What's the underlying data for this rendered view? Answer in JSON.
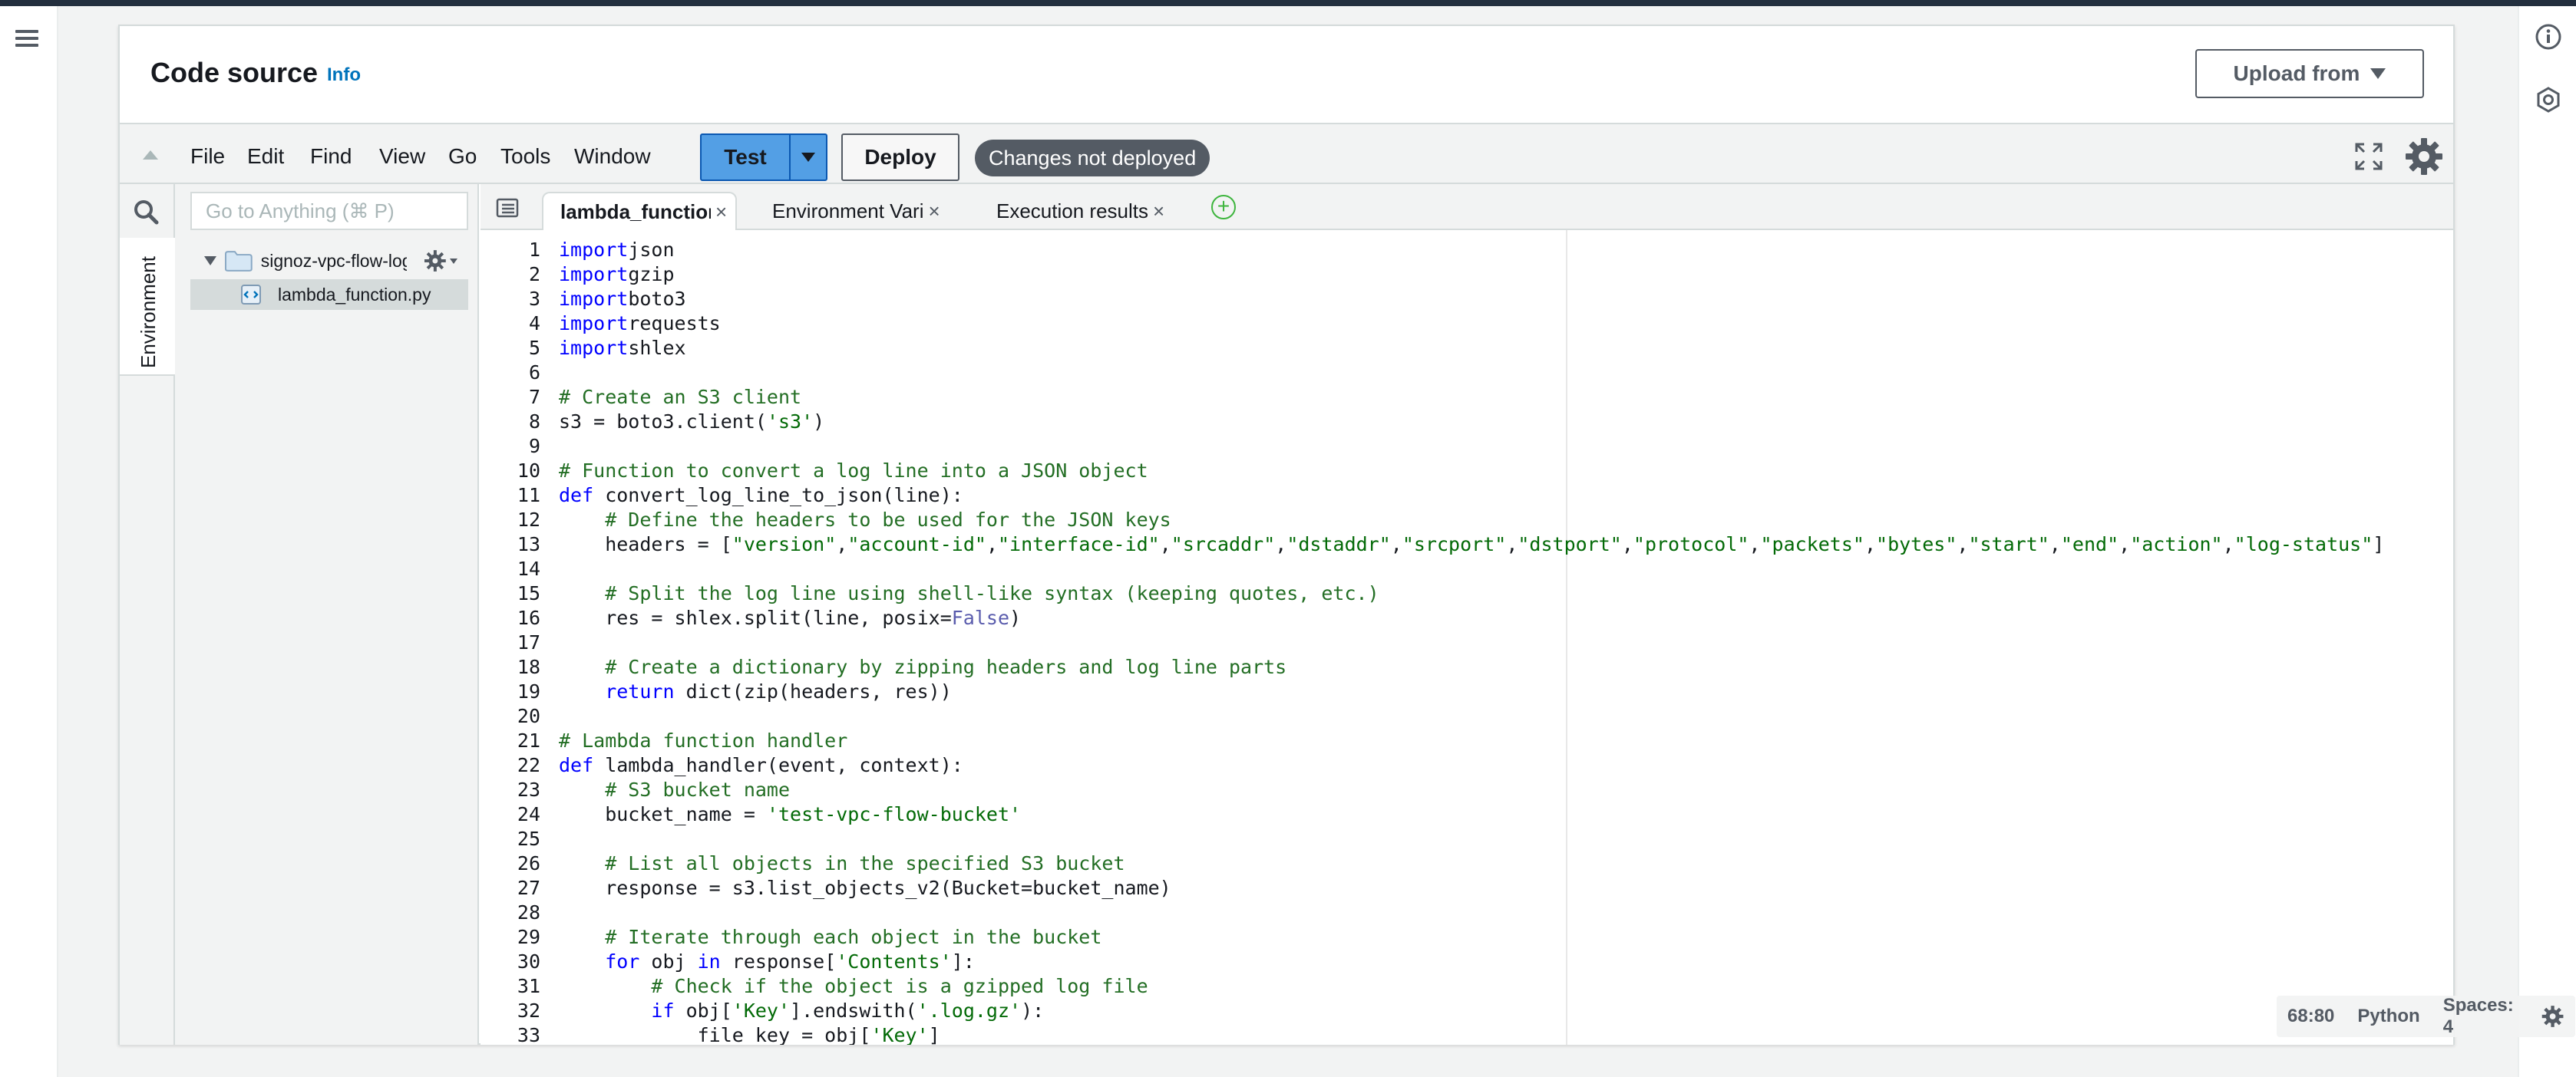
{
  "nav": {
    "menu_icon": "hamburger-icon"
  },
  "right_rail": {
    "icons": [
      "info-icon",
      "circle-diamond-icon"
    ]
  },
  "header": {
    "title": "Code source",
    "info_link": "Info",
    "upload_button": "Upload from"
  },
  "menubar": {
    "items": [
      "File",
      "Edit",
      "Find",
      "View",
      "Go",
      "Tools",
      "Window"
    ],
    "test_button": "Test",
    "deploy_button": "Deploy",
    "status": "Changes not deployed"
  },
  "sidebar": {
    "tab_label": "Environment",
    "search_placeholder": "Go to Anything (⌘ P)",
    "tree": {
      "folder": "signoz-vpc-flow-logs",
      "file": "lambda_function.py"
    }
  },
  "editor": {
    "tabs": [
      {
        "label": "lambda_function",
        "active": true
      },
      {
        "label": "Environment Vari",
        "active": false
      },
      {
        "label": "Execution results",
        "active": false
      }
    ],
    "close_glyph": "×",
    "add_glyph": "+",
    "line_numbers": [
      "1",
      "2",
      "3",
      "4",
      "5",
      "6",
      "7",
      "8",
      "9",
      "10",
      "11",
      "12",
      "13",
      "14",
      "15",
      "16",
      "17",
      "18",
      "19",
      "20",
      "21",
      "22",
      "23",
      "24",
      "25",
      "26",
      "27",
      "28",
      "29",
      "30",
      "31",
      "32",
      "33"
    ],
    "lines": [
      [
        [
          "kw",
          "import"
        ],
        [
          "",
          "json"
        ]
      ],
      [
        [
          "kw",
          "import"
        ],
        [
          "",
          "gzip"
        ]
      ],
      [
        [
          "kw",
          "import"
        ],
        [
          "",
          "boto3"
        ]
      ],
      [
        [
          "kw",
          "import"
        ],
        [
          "",
          "requests"
        ]
      ],
      [
        [
          "kw",
          "import"
        ],
        [
          "",
          "shlex"
        ]
      ],
      [],
      [
        [
          "cm",
          "# Create an S3 client"
        ]
      ],
      [
        [
          "",
          "s3 = boto3.client("
        ],
        [
          "str",
          "'s3'"
        ],
        [
          "",
          ")"
        ]
      ],
      [],
      [
        [
          "cm",
          "# Function to convert a log line into a JSON object"
        ]
      ],
      [
        [
          "kw",
          "def"
        ],
        [
          "",
          " convert_log_line_to_json(line):"
        ]
      ],
      [
        [
          "cm",
          "    # Define the headers to be used for the JSON keys"
        ]
      ],
      [
        [
          "",
          "    headers = ["
        ],
        [
          "str",
          "\"version\""
        ],
        [
          "",
          ","
        ],
        [
          "str",
          "\"account-id\""
        ],
        [
          "",
          ","
        ],
        [
          "str",
          "\"interface-id\""
        ],
        [
          "",
          ","
        ],
        [
          "str",
          "\"srcaddr\""
        ],
        [
          "",
          ","
        ],
        [
          "str",
          "\"dstaddr\""
        ],
        [
          "",
          ","
        ],
        [
          "str",
          "\"srcport\""
        ],
        [
          "",
          ","
        ],
        [
          "str",
          "\"dstport\""
        ],
        [
          "",
          ","
        ],
        [
          "str",
          "\"protocol\""
        ],
        [
          "",
          ","
        ],
        [
          "str",
          "\"packets\""
        ],
        [
          "",
          ","
        ],
        [
          "str",
          "\"bytes\""
        ],
        [
          "",
          ","
        ],
        [
          "str",
          "\"start\""
        ],
        [
          "",
          ","
        ],
        [
          "str",
          "\"end\""
        ],
        [
          "",
          ","
        ],
        [
          "str",
          "\"action\""
        ],
        [
          "",
          ","
        ],
        [
          "str",
          "\"log-status\""
        ],
        [
          "",
          "]"
        ]
      ],
      [],
      [
        [
          "cm",
          "    # Split the log line using shell-like syntax (keeping quotes, etc.)"
        ]
      ],
      [
        [
          "",
          "    res = shlex.split(line, posix="
        ],
        [
          "cst",
          "False"
        ],
        [
          "",
          ")"
        ]
      ],
      [],
      [
        [
          "cm",
          "    # Create a dictionary by zipping headers and log line parts"
        ]
      ],
      [
        [
          "kw",
          "    return"
        ],
        [
          "",
          " dict(zip(headers, res))"
        ]
      ],
      [],
      [
        [
          "cm",
          "# Lambda function handler"
        ]
      ],
      [
        [
          "kw",
          "def"
        ],
        [
          "",
          " lambda_handler(event, context):"
        ]
      ],
      [
        [
          "cm",
          "    # S3 bucket name"
        ]
      ],
      [
        [
          "",
          "    bucket_name = "
        ],
        [
          "str",
          "'test-vpc-flow-bucket'"
        ]
      ],
      [],
      [
        [
          "cm",
          "    # List all objects in the specified S3 bucket"
        ]
      ],
      [
        [
          "",
          "    response = s3.list_objects_v2(Bucket=bucket_name)"
        ]
      ],
      [],
      [
        [
          "cm",
          "    # Iterate through each object in the bucket"
        ]
      ],
      [
        [
          "kw",
          "    for"
        ],
        [
          "",
          " obj "
        ],
        [
          "kw",
          "in"
        ],
        [
          "",
          " response["
        ],
        [
          "str",
          "'Contents'"
        ],
        [
          "",
          "]:"
        ]
      ],
      [
        [
          "cm",
          "        # Check if the object is a gzipped log file"
        ]
      ],
      [
        [
          "kw",
          "        if"
        ],
        [
          "",
          " obj["
        ],
        [
          "str",
          "'Key'"
        ],
        [
          "",
          "].endswith("
        ],
        [
          "str",
          "'.log.gz'"
        ],
        [
          "",
          "):"
        ]
      ],
      [
        [
          "",
          "            file_key = obj["
        ],
        [
          "str",
          "'Key'"
        ],
        [
          "",
          "]"
        ]
      ]
    ]
  },
  "status_bar": {
    "position": "68:80",
    "language": "Python",
    "indent": "Spaces: 4"
  },
  "colors": {
    "accent_blue": "#539fe5",
    "link": "#0073bb",
    "pill": "#545b64",
    "keyword": "#0000ff",
    "comment": "#236e24",
    "string": "#036a07"
  }
}
